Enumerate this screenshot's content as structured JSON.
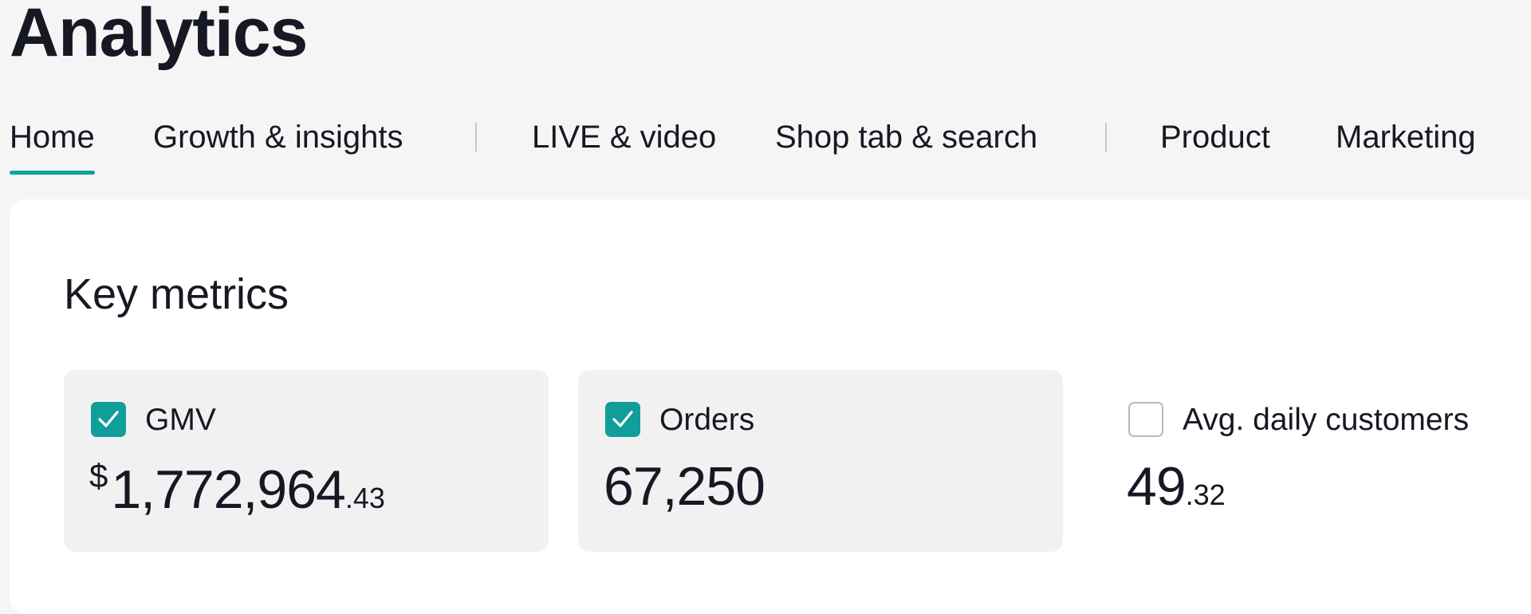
{
  "header": {
    "title": "Analytics"
  },
  "tabs": [
    {
      "label": "Home",
      "active": true
    },
    {
      "label": "Growth & insights",
      "active": false
    },
    {
      "label": "LIVE & video",
      "active": false
    },
    {
      "label": "Shop tab & search",
      "active": false
    },
    {
      "label": "Product",
      "active": false
    },
    {
      "label": "Marketing",
      "active": false
    }
  ],
  "key_metrics": {
    "title": "Key metrics",
    "cards": [
      {
        "label": "GMV",
        "checked": true,
        "currency": "$",
        "value": "1,772,964",
        "decimal": ".43"
      },
      {
        "label": "Orders",
        "checked": true,
        "value": "67,250"
      },
      {
        "label": "Avg. daily customers",
        "checked": false,
        "value": "49",
        "decimal": ".32"
      }
    ]
  },
  "colors": {
    "accent": "#0fa3a0",
    "checkbox_checked": "#119e9b",
    "page_background": "#f5f5f5",
    "card_background": "#f1f1f2",
    "text": "#161823"
  },
  "icons": {
    "checkbox_checked": "check-icon"
  }
}
